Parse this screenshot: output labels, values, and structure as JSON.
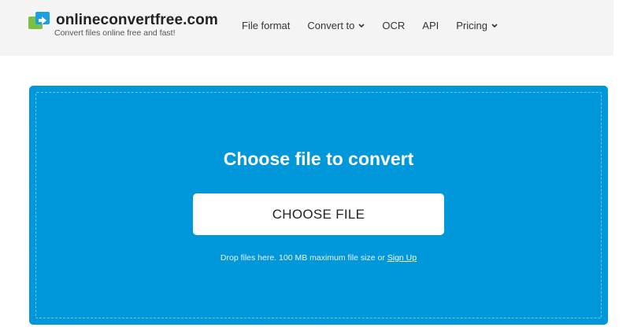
{
  "brand": {
    "name": "onlineconvertfree.com",
    "tagline": "Convert files online free and fast!"
  },
  "nav": {
    "items": [
      {
        "label": "File format",
        "dropdown": false
      },
      {
        "label": "Convert to",
        "dropdown": true
      },
      {
        "label": "OCR",
        "dropdown": false
      },
      {
        "label": "API",
        "dropdown": false
      },
      {
        "label": "Pricing",
        "dropdown": true
      }
    ]
  },
  "upload": {
    "title": "Choose file to convert",
    "button_label": "CHOOSE FILE",
    "note_text": "Drop files here. 100 MB maximum file size or ",
    "signup_link": "Sign Up"
  },
  "colors": {
    "header_bg": "#f4f4f5",
    "upload_bg": "#0098da",
    "logo_green": "#7ac143",
    "logo_blue": "#1ba1e2"
  },
  "icons": {
    "logo": "convert-arrows-icon",
    "dropdown": "chevron-down-icon"
  }
}
